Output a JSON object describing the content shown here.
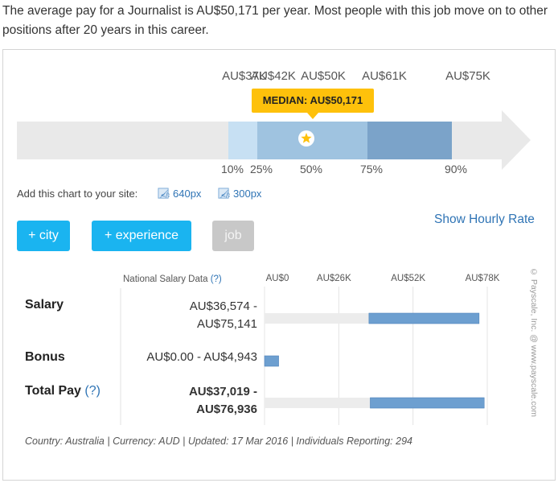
{
  "intro_text": "The average pay for a Journalist is AU$50,171 per year. Most people with this job move on to other positions after 20 years in this career.",
  "colors": {
    "accent": "#1ab4f0",
    "median_badge": "#fec10b",
    "link": "#2f74b5",
    "range_bar": "#6d9fd0",
    "disabled": "#c8c8c8"
  },
  "chart_data": [
    {
      "type": "range-bar",
      "scale_labels": [
        "AU$37K",
        "AU$42K",
        "AU$50K",
        "AU$61K",
        "AU$75K"
      ],
      "percentile_labels": [
        "10%",
        "25%",
        "50%",
        "75%",
        "90%"
      ],
      "percentiles": [
        {
          "pct": 10,
          "value": 37000
        },
        {
          "pct": 25,
          "value": 42000
        },
        {
          "pct": 50,
          "value": 50171
        },
        {
          "pct": 75,
          "value": 61000
        },
        {
          "pct": 90,
          "value": 75000
        }
      ],
      "median": 50171,
      "median_label": "MEDIAN: AU$50,171",
      "marker_icon": "star-icon"
    },
    {
      "type": "bar",
      "orientation": "horizontal-range",
      "axis_labels": [
        "AU$0",
        "AU$26K",
        "AU$52K",
        "AU$78K"
      ],
      "xlim": [
        0,
        78000
      ],
      "rows": [
        {
          "name": "Salary",
          "low": 36574,
          "high": 75141,
          "range_text": [
            "AU$36,574 -",
            "AU$75,141"
          ]
        },
        {
          "name": "Bonus",
          "low": 0,
          "high": 4943,
          "range_text": [
            "AU$0.00 - AU$4,943"
          ]
        },
        {
          "name": "Total Pay",
          "low": 37019,
          "high": 76936,
          "range_text": [
            "AU$37,019 -",
            "AU$76,936"
          ]
        }
      ]
    }
  ],
  "embed": {
    "label": "Add this chart to your site:",
    "links": [
      "640px",
      "300px"
    ],
    "icon": "embed-code-icon"
  },
  "buttons": {
    "city": "+ city",
    "experience": "+ experience",
    "job": "job"
  },
  "show_hourly": "Show Hourly Rate",
  "table": {
    "header": "National Salary Data",
    "help_mark": "(?)",
    "total_pay_label": "Total Pay"
  },
  "footer": "Country: Australia | Currency: AUD | Updated: 17 Mar 2016 | Individuals Reporting: 294",
  "watermark": "© Payscale, Inc. @ www.payscale.com"
}
